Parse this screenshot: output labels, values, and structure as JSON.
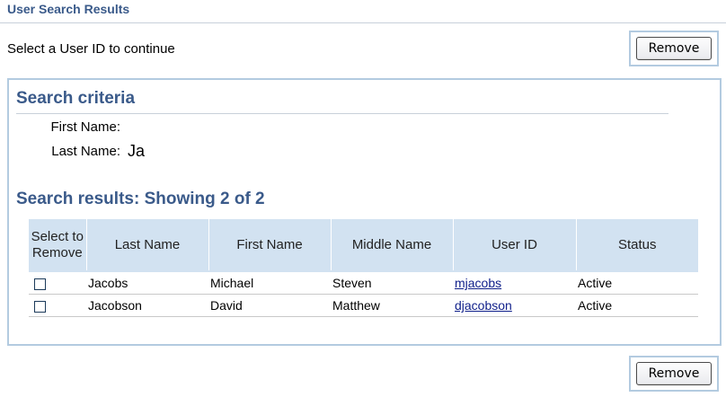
{
  "page": {
    "title": "User Search Results",
    "instructions": "Select a User ID to continue"
  },
  "buttons": {
    "top_remove": "Remove",
    "bottom_remove": "Remove"
  },
  "criteria": {
    "heading": "Search criteria",
    "first_name_label": "First Name:",
    "first_name_value": "",
    "last_name_label": "Last Name:",
    "last_name_value": "Ja"
  },
  "results": {
    "heading": "Search results: Showing 2 of 2",
    "columns": {
      "select": "Select to Remove",
      "last_name": "Last Name",
      "first_name": "First Name",
      "middle_name": "Middle Name",
      "user_id": "User ID",
      "status": "Status"
    },
    "rows": [
      {
        "last_name": "Jacobs",
        "first_name": "Michael",
        "middle_name": "Steven",
        "user_id": "mjacobs",
        "status": "Active"
      },
      {
        "last_name": "Jacobson",
        "first_name": "David",
        "middle_name": "Matthew",
        "user_id": "djacobson",
        "status": "Active"
      }
    ]
  }
}
